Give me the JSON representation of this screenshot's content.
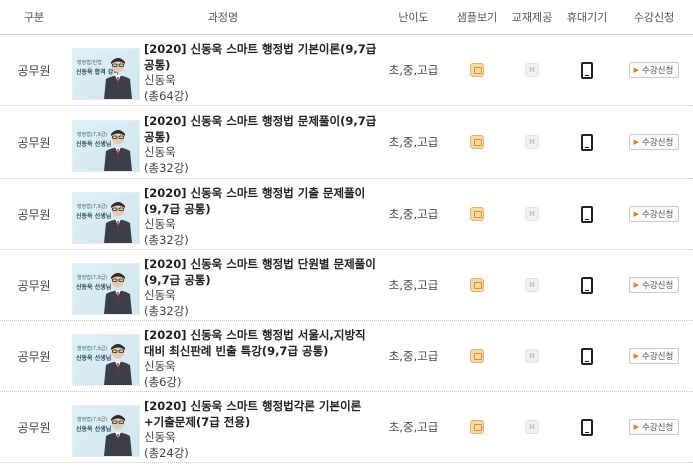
{
  "header": {
    "category": "구분",
    "course": "과정명",
    "level": "난이도",
    "sample": "샘플보기",
    "textbook": "교재제공",
    "mobile": "휴대기기",
    "enroll": "수강신청"
  },
  "rows": [
    {
      "category": "공무원",
      "thumb_line1": "행정법/헌법",
      "thumb_line2": "신동욱 합격 강의",
      "title": "[2020] 신동욱 스마트 행정법 기본이론(9,7급 공통)",
      "teacher": "신동욱",
      "lessons": "(총64강)",
      "level": "초,중,고급",
      "book_label": "N",
      "enroll_label": "수강신청"
    },
    {
      "category": "공무원",
      "thumb_line1": "행정법(7,9급)",
      "thumb_line2": "신동욱 선생님",
      "title": "[2020] 신동욱 스마트 행정법 문제풀이(9,7급 공통)",
      "teacher": "신동욱",
      "lessons": "(총32강)",
      "level": "초,중,고급",
      "book_label": "N",
      "enroll_label": "수강신청"
    },
    {
      "category": "공무원",
      "thumb_line1": "행정법(7,9급)",
      "thumb_line2": "신동욱 선생님",
      "title": "[2020] 신동욱 스마트 행정법 기출 문제풀이(9,7급 공통)",
      "teacher": "신동욱",
      "lessons": "(총32강)",
      "level": "초,중,고급",
      "book_label": "N",
      "enroll_label": "수강신청"
    },
    {
      "category": "공무원",
      "thumb_line1": "행정법(7,9급)",
      "thumb_line2": "신동욱 선생님",
      "title": "[2020] 신동욱 스마트 행정법 단원별 문제풀이(9,7급 공통)",
      "teacher": "신동욱",
      "lessons": "(총32강)",
      "level": "초,중,고급",
      "book_label": "N",
      "enroll_label": "수강신청"
    },
    {
      "category": "공무원",
      "thumb_line1": "행정법(7,9급)",
      "thumb_line2": "신동욱 선생님",
      "title": "[2020] 신동욱 스마트 행정법 서울시,지방직 대비 최신판례 빈출 특강(9,7급 공통)",
      "teacher": "신동욱",
      "lessons": "(총6강)",
      "level": "초,중,고급",
      "book_label": "N",
      "enroll_label": "수강신청"
    },
    {
      "category": "공무원",
      "thumb_line1": "행정법(7,9급)",
      "thumb_line2": "신동욱 선생님",
      "title": "[2020] 신동욱 스마트 행정법각론 기본이론+기출문제(7급 전용)",
      "teacher": "신동욱",
      "lessons": "(총24강)",
      "level": "초,중,고급",
      "book_label": "N",
      "enroll_label": "수강신청"
    }
  ],
  "icons": {
    "sample": "video-play-icon",
    "textbook": "textbook-unavailable-icon",
    "mobile": "mobile-phone-icon",
    "enroll_arrow": "play-arrow-icon"
  },
  "colors": {
    "accent_orange": "#e07b1e",
    "header_border": "#cfcfcf"
  }
}
